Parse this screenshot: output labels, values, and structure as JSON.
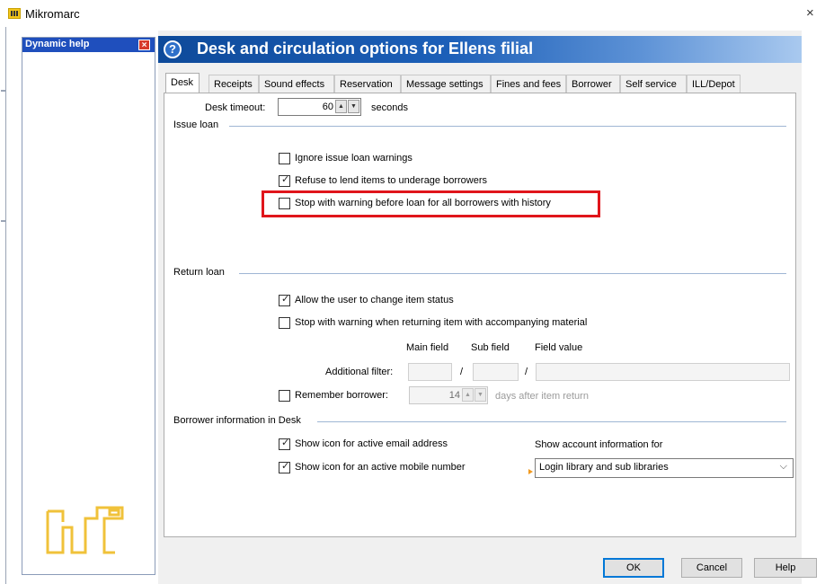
{
  "window": {
    "title": "Mikromarc",
    "close_glyph": "×"
  },
  "help_pane": {
    "title": "Dynamic help",
    "close_glyph": "×"
  },
  "dialog": {
    "title": "Desk and circulation options for Ellens filial",
    "help_glyph": "?",
    "tabs": [
      {
        "label": "Desk",
        "active": true
      },
      {
        "label": "Receipts"
      },
      {
        "label": "Sound effects"
      },
      {
        "label": "Reservation"
      },
      {
        "label": "Message settings"
      },
      {
        "label": "Fines and fees"
      },
      {
        "label": "Borrower"
      },
      {
        "label": "Self service"
      },
      {
        "label": "ILL/Depot"
      }
    ],
    "desk_timeout": {
      "label": "Desk timeout:",
      "value": "60",
      "unit": "seconds"
    },
    "issue_loan": {
      "title": "Issue loan",
      "options": [
        {
          "label": "Ignore issue loan warnings",
          "checked": false
        },
        {
          "label": "Refuse to lend items to underage borrowers",
          "checked": true
        },
        {
          "label": "Stop with warning before loan for all borrowers with history",
          "checked": false
        }
      ]
    },
    "return_loan": {
      "title": "Return loan",
      "options": [
        {
          "label": "Allow the user to change item status",
          "checked": true
        },
        {
          "label": "Stop with warning when returning item with accompanying material",
          "checked": false
        }
      ],
      "filter_headers": {
        "main": "Main field",
        "sub": "Sub field",
        "value": "Field value"
      },
      "additional_filter_label": "Additional filter:",
      "separator": "/",
      "remember_borrower": {
        "label": "Remember borrower:",
        "checked": false,
        "value": "14",
        "suffix": "days after item return"
      }
    },
    "borrower_info": {
      "title": "Borrower information in Desk",
      "options": [
        {
          "label": "Show icon for active email address",
          "checked": true
        },
        {
          "label": "Show icon for an active mobile number",
          "checked": true
        }
      ],
      "account_label": "Show account information for",
      "account_value": "Login library and sub libraries"
    },
    "buttons": {
      "ok": "OK",
      "cancel": "Cancel",
      "help": "Help"
    }
  },
  "colors": {
    "header_blue": "#1c5fb8",
    "highlight_red": "#e0151b",
    "help_header": "#1f4fbd"
  },
  "icons": {
    "check": "✓",
    "spin_up": "▲",
    "spin_down": "▼",
    "dropdown": "⌵"
  }
}
